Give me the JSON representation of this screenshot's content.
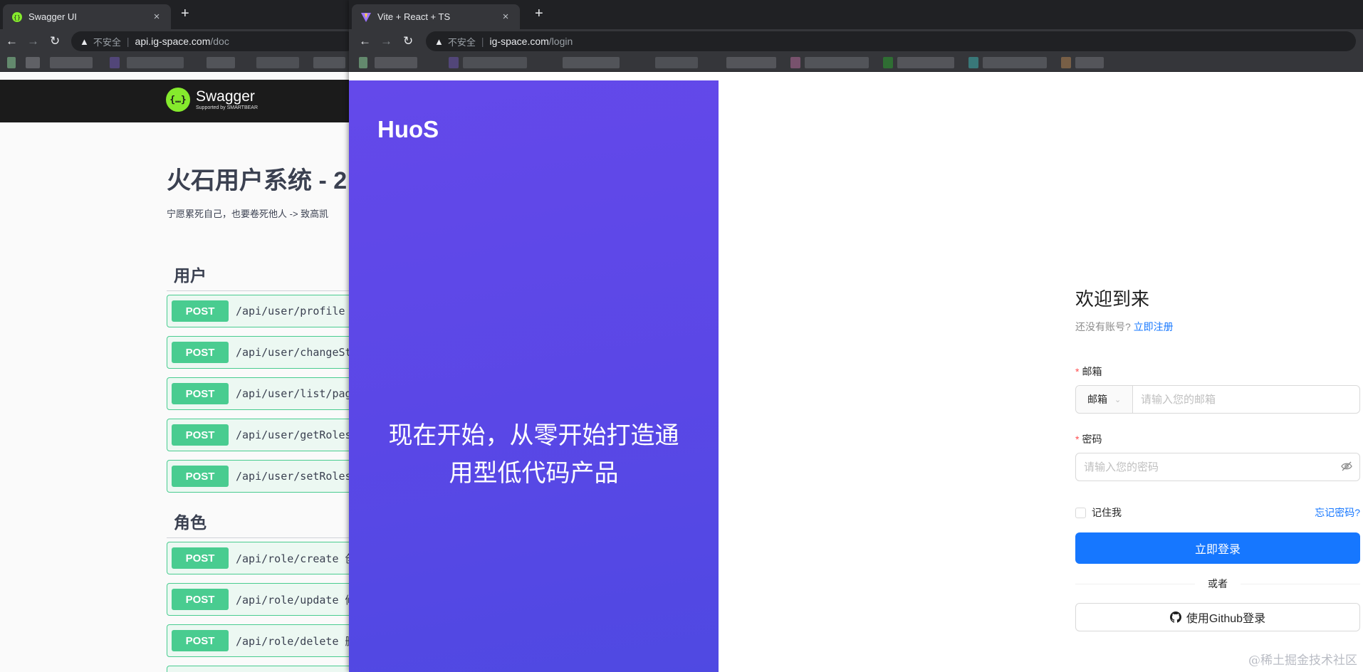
{
  "left_window": {
    "tab": {
      "title": "Swagger UI",
      "close": "×"
    },
    "new_tab": "+",
    "nav": {
      "back": "←",
      "forward": "→",
      "reload": "↻"
    },
    "address": {
      "warning_icon": "▲",
      "insecure": "不安全",
      "separator": "|",
      "domain": "api.ig-space.com",
      "path": "/doc"
    },
    "swagger": {
      "logo_glyph": "{…}",
      "brand": "Swagger",
      "brand_sub": "Supported by SMARTBEAR",
      "title": "火石用户系统 - 2",
      "description": "宁愿累死自己，也要卷死他人 -> 致高凯",
      "sections": [
        {
          "name": "用户",
          "ops": [
            {
              "method": "POST",
              "path": "/api/user/profile"
            },
            {
              "method": "POST",
              "path": "/api/user/changeSt"
            },
            {
              "method": "POST",
              "path": "/api/user/list/pag"
            },
            {
              "method": "POST",
              "path": "/api/user/getRoles"
            },
            {
              "method": "POST",
              "path": "/api/user/setRoles"
            }
          ]
        },
        {
          "name": "角色",
          "ops": [
            {
              "method": "POST",
              "path": "/api/role/create 创"
            },
            {
              "method": "POST",
              "path": "/api/role/update 修"
            },
            {
              "method": "POST",
              "path": "/api/role/delete 删"
            }
          ]
        }
      ]
    }
  },
  "right_window": {
    "tab": {
      "title": "Vite + React + TS",
      "close": "×"
    },
    "new_tab": "+",
    "nav": {
      "back": "←",
      "forward": "→",
      "reload": "↻"
    },
    "address": {
      "warning_icon": "▲",
      "insecure": "不安全",
      "separator": "|",
      "domain": "ig-space.com",
      "path": "/login"
    },
    "hero": {
      "brand": "HuoS",
      "slogan_line1": "现在开始，从零开始打造通",
      "slogan_line2": "用型低代码产品"
    },
    "login": {
      "welcome": "欢迎到来",
      "no_account": "还没有账号?",
      "register_link": "立即注册",
      "email_label": "邮箱",
      "email_type_option": "邮箱",
      "email_placeholder": "请输入您的邮箱",
      "password_label": "密码",
      "password_placeholder": "请输入您的密码",
      "remember_me": "记住我",
      "forgot_password": "忘记密码?",
      "login_button": "立即登录",
      "divider_text": "或者",
      "github_button": "使用Github登录",
      "required_mark": "*"
    },
    "watermark": "@稀土掘金技术社区"
  },
  "colors": {
    "chrome_dark": "#202124",
    "chrome_toolbar": "#35363a",
    "swagger_green": "#49cc90",
    "hero_purple": "#5a47e6",
    "primary_blue": "#1677ff"
  }
}
